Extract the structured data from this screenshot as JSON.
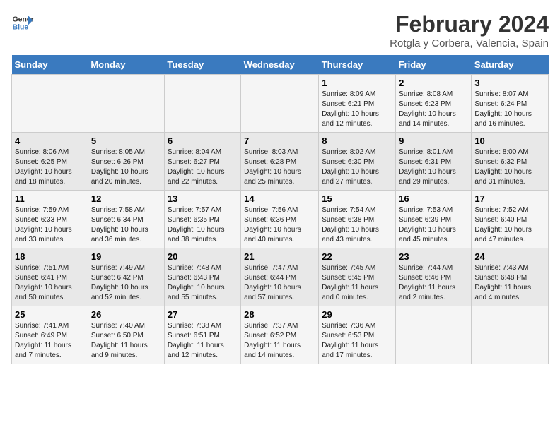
{
  "header": {
    "logo_line1": "General",
    "logo_line2": "Blue",
    "month_title": "February 2024",
    "location": "Rotgla y Corbera, Valencia, Spain"
  },
  "days_of_week": [
    "Sunday",
    "Monday",
    "Tuesday",
    "Wednesday",
    "Thursday",
    "Friday",
    "Saturday"
  ],
  "weeks": [
    [
      {
        "day": "",
        "info": ""
      },
      {
        "day": "",
        "info": ""
      },
      {
        "day": "",
        "info": ""
      },
      {
        "day": "",
        "info": ""
      },
      {
        "day": "1",
        "info": "Sunrise: 8:09 AM\nSunset: 6:21 PM\nDaylight: 10 hours\nand 12 minutes."
      },
      {
        "day": "2",
        "info": "Sunrise: 8:08 AM\nSunset: 6:23 PM\nDaylight: 10 hours\nand 14 minutes."
      },
      {
        "day": "3",
        "info": "Sunrise: 8:07 AM\nSunset: 6:24 PM\nDaylight: 10 hours\nand 16 minutes."
      }
    ],
    [
      {
        "day": "4",
        "info": "Sunrise: 8:06 AM\nSunset: 6:25 PM\nDaylight: 10 hours\nand 18 minutes."
      },
      {
        "day": "5",
        "info": "Sunrise: 8:05 AM\nSunset: 6:26 PM\nDaylight: 10 hours\nand 20 minutes."
      },
      {
        "day": "6",
        "info": "Sunrise: 8:04 AM\nSunset: 6:27 PM\nDaylight: 10 hours\nand 22 minutes."
      },
      {
        "day": "7",
        "info": "Sunrise: 8:03 AM\nSunset: 6:28 PM\nDaylight: 10 hours\nand 25 minutes."
      },
      {
        "day": "8",
        "info": "Sunrise: 8:02 AM\nSunset: 6:30 PM\nDaylight: 10 hours\nand 27 minutes."
      },
      {
        "day": "9",
        "info": "Sunrise: 8:01 AM\nSunset: 6:31 PM\nDaylight: 10 hours\nand 29 minutes."
      },
      {
        "day": "10",
        "info": "Sunrise: 8:00 AM\nSunset: 6:32 PM\nDaylight: 10 hours\nand 31 minutes."
      }
    ],
    [
      {
        "day": "11",
        "info": "Sunrise: 7:59 AM\nSunset: 6:33 PM\nDaylight: 10 hours\nand 33 minutes."
      },
      {
        "day": "12",
        "info": "Sunrise: 7:58 AM\nSunset: 6:34 PM\nDaylight: 10 hours\nand 36 minutes."
      },
      {
        "day": "13",
        "info": "Sunrise: 7:57 AM\nSunset: 6:35 PM\nDaylight: 10 hours\nand 38 minutes."
      },
      {
        "day": "14",
        "info": "Sunrise: 7:56 AM\nSunset: 6:36 PM\nDaylight: 10 hours\nand 40 minutes."
      },
      {
        "day": "15",
        "info": "Sunrise: 7:54 AM\nSunset: 6:38 PM\nDaylight: 10 hours\nand 43 minutes."
      },
      {
        "day": "16",
        "info": "Sunrise: 7:53 AM\nSunset: 6:39 PM\nDaylight: 10 hours\nand 45 minutes."
      },
      {
        "day": "17",
        "info": "Sunrise: 7:52 AM\nSunset: 6:40 PM\nDaylight: 10 hours\nand 47 minutes."
      }
    ],
    [
      {
        "day": "18",
        "info": "Sunrise: 7:51 AM\nSunset: 6:41 PM\nDaylight: 10 hours\nand 50 minutes."
      },
      {
        "day": "19",
        "info": "Sunrise: 7:49 AM\nSunset: 6:42 PM\nDaylight: 10 hours\nand 52 minutes."
      },
      {
        "day": "20",
        "info": "Sunrise: 7:48 AM\nSunset: 6:43 PM\nDaylight: 10 hours\nand 55 minutes."
      },
      {
        "day": "21",
        "info": "Sunrise: 7:47 AM\nSunset: 6:44 PM\nDaylight: 10 hours\nand 57 minutes."
      },
      {
        "day": "22",
        "info": "Sunrise: 7:45 AM\nSunset: 6:45 PM\nDaylight: 11 hours\nand 0 minutes."
      },
      {
        "day": "23",
        "info": "Sunrise: 7:44 AM\nSunset: 6:46 PM\nDaylight: 11 hours\nand 2 minutes."
      },
      {
        "day": "24",
        "info": "Sunrise: 7:43 AM\nSunset: 6:48 PM\nDaylight: 11 hours\nand 4 minutes."
      }
    ],
    [
      {
        "day": "25",
        "info": "Sunrise: 7:41 AM\nSunset: 6:49 PM\nDaylight: 11 hours\nand 7 minutes."
      },
      {
        "day": "26",
        "info": "Sunrise: 7:40 AM\nSunset: 6:50 PM\nDaylight: 11 hours\nand 9 minutes."
      },
      {
        "day": "27",
        "info": "Sunrise: 7:38 AM\nSunset: 6:51 PM\nDaylight: 11 hours\nand 12 minutes."
      },
      {
        "day": "28",
        "info": "Sunrise: 7:37 AM\nSunset: 6:52 PM\nDaylight: 11 hours\nand 14 minutes."
      },
      {
        "day": "29",
        "info": "Sunrise: 7:36 AM\nSunset: 6:53 PM\nDaylight: 11 hours\nand 17 minutes."
      },
      {
        "day": "",
        "info": ""
      },
      {
        "day": "",
        "info": ""
      }
    ]
  ]
}
